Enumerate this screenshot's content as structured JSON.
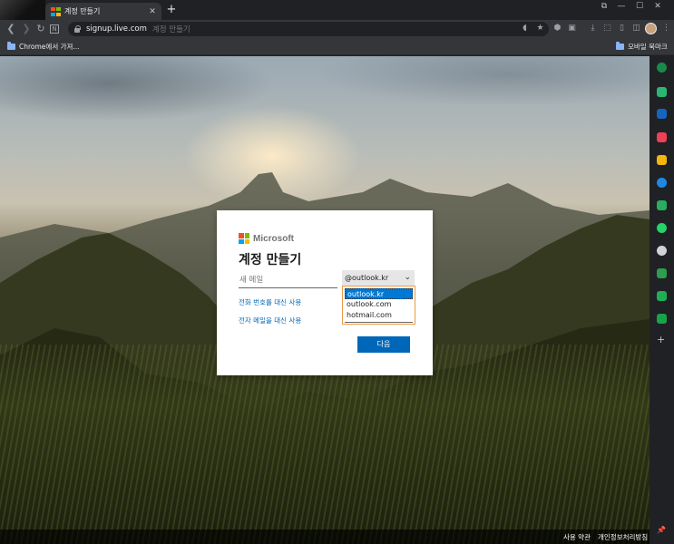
{
  "browser": {
    "tab": {
      "title": "계정 만들기",
      "close": "✕"
    },
    "new_tab": "+",
    "window_controls": [
      "⧉",
      "—",
      "☐",
      "✕"
    ],
    "url": "signup.live.com",
    "page_title_hint": "계정 만들기",
    "bookmarks": {
      "left": "Chrome에서 가져...",
      "right": "모바일 북마크"
    },
    "colors": {
      "chrome_dark": "#202124",
      "chrome_toolbar": "#35363a",
      "folder": "#8ab4f8"
    }
  },
  "signup": {
    "brand": "Microsoft",
    "heading": "계정 만들기",
    "email_placeholder": "새 메일",
    "email_value": "",
    "domain_selected": "@outlook.kr",
    "domain_options": [
      "outlook.kr",
      "outlook.com",
      "hotmail.com"
    ],
    "use_phone_link": "전화 번호를 대신 사용",
    "use_email_link": "전자 메일을 대신 사용",
    "next_button": "다음",
    "colors": {
      "accent": "#0067b8",
      "selected_option": "#0078d4",
      "focus_outline": "#ef9a43"
    }
  },
  "footer": {
    "terms": "사용 약관",
    "privacy": "개인정보처리방침"
  },
  "side_panel": {
    "icons": [
      "edge-circle-icon",
      "bell-icon",
      "outlook-icon",
      "pocket-icon",
      "star-icon",
      "edge-icon",
      "green-app-icon",
      "whatsapp-icon",
      "github-icon",
      "camera-icon",
      "chat-icon",
      "bookmark-app-icon",
      "add-icon"
    ],
    "pin": "📌"
  }
}
